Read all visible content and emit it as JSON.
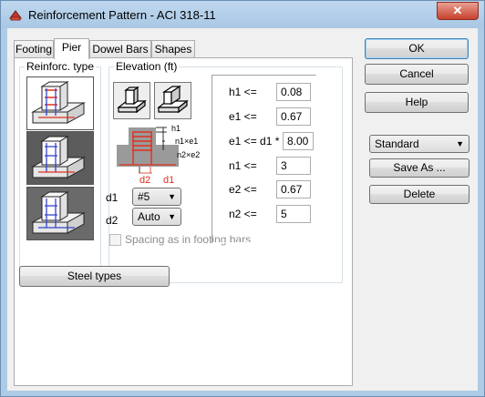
{
  "window": {
    "title": "Reinforcement Pattern - ACI 318-11",
    "close_glyph": "✕"
  },
  "tabs": [
    {
      "label": "Footing"
    },
    {
      "label": "Pier"
    },
    {
      "label": "Dowel Bars"
    },
    {
      "label": "Shapes"
    }
  ],
  "reinforc_type": {
    "label": "Reinforc. type",
    "options": [
      "pattern-1",
      "pattern-2",
      "pattern-3"
    ],
    "selected_index": 1
  },
  "elevation": {
    "label": "Elevation (ft)",
    "diagram_labels": {
      "h1": "h1",
      "n1e1": "n1×e1",
      "n2e2": "n2×e2",
      "d2": "d2",
      "d1": "d1"
    },
    "d1_label": "d1",
    "d1_value": "#5",
    "d2_label": "d2",
    "d2_value": "Auto",
    "spacing_label": "Spacing as in footing bars"
  },
  "params": [
    {
      "label": "h1 <=",
      "value": "0.08"
    },
    {
      "label": "e1 <=",
      "value": "0.67"
    },
    {
      "label": "e1 <= d1 *",
      "value": "8.00"
    },
    {
      "label": "n1 <=",
      "value": "3"
    },
    {
      "label": "e2 <=",
      "value": "0.67"
    },
    {
      "label": "n2 <=",
      "value": "5"
    }
  ],
  "buttons": {
    "steel_types": "Steel types",
    "ok": "OK",
    "cancel": "Cancel",
    "help": "Help",
    "save_as": "Save As ...",
    "delete": "Delete"
  },
  "preset": {
    "value": "Standard"
  },
  "colors": {
    "rebar_red": "#e0301e",
    "rebar_blue": "#3344cc",
    "title_bg": "#aecbe6"
  }
}
